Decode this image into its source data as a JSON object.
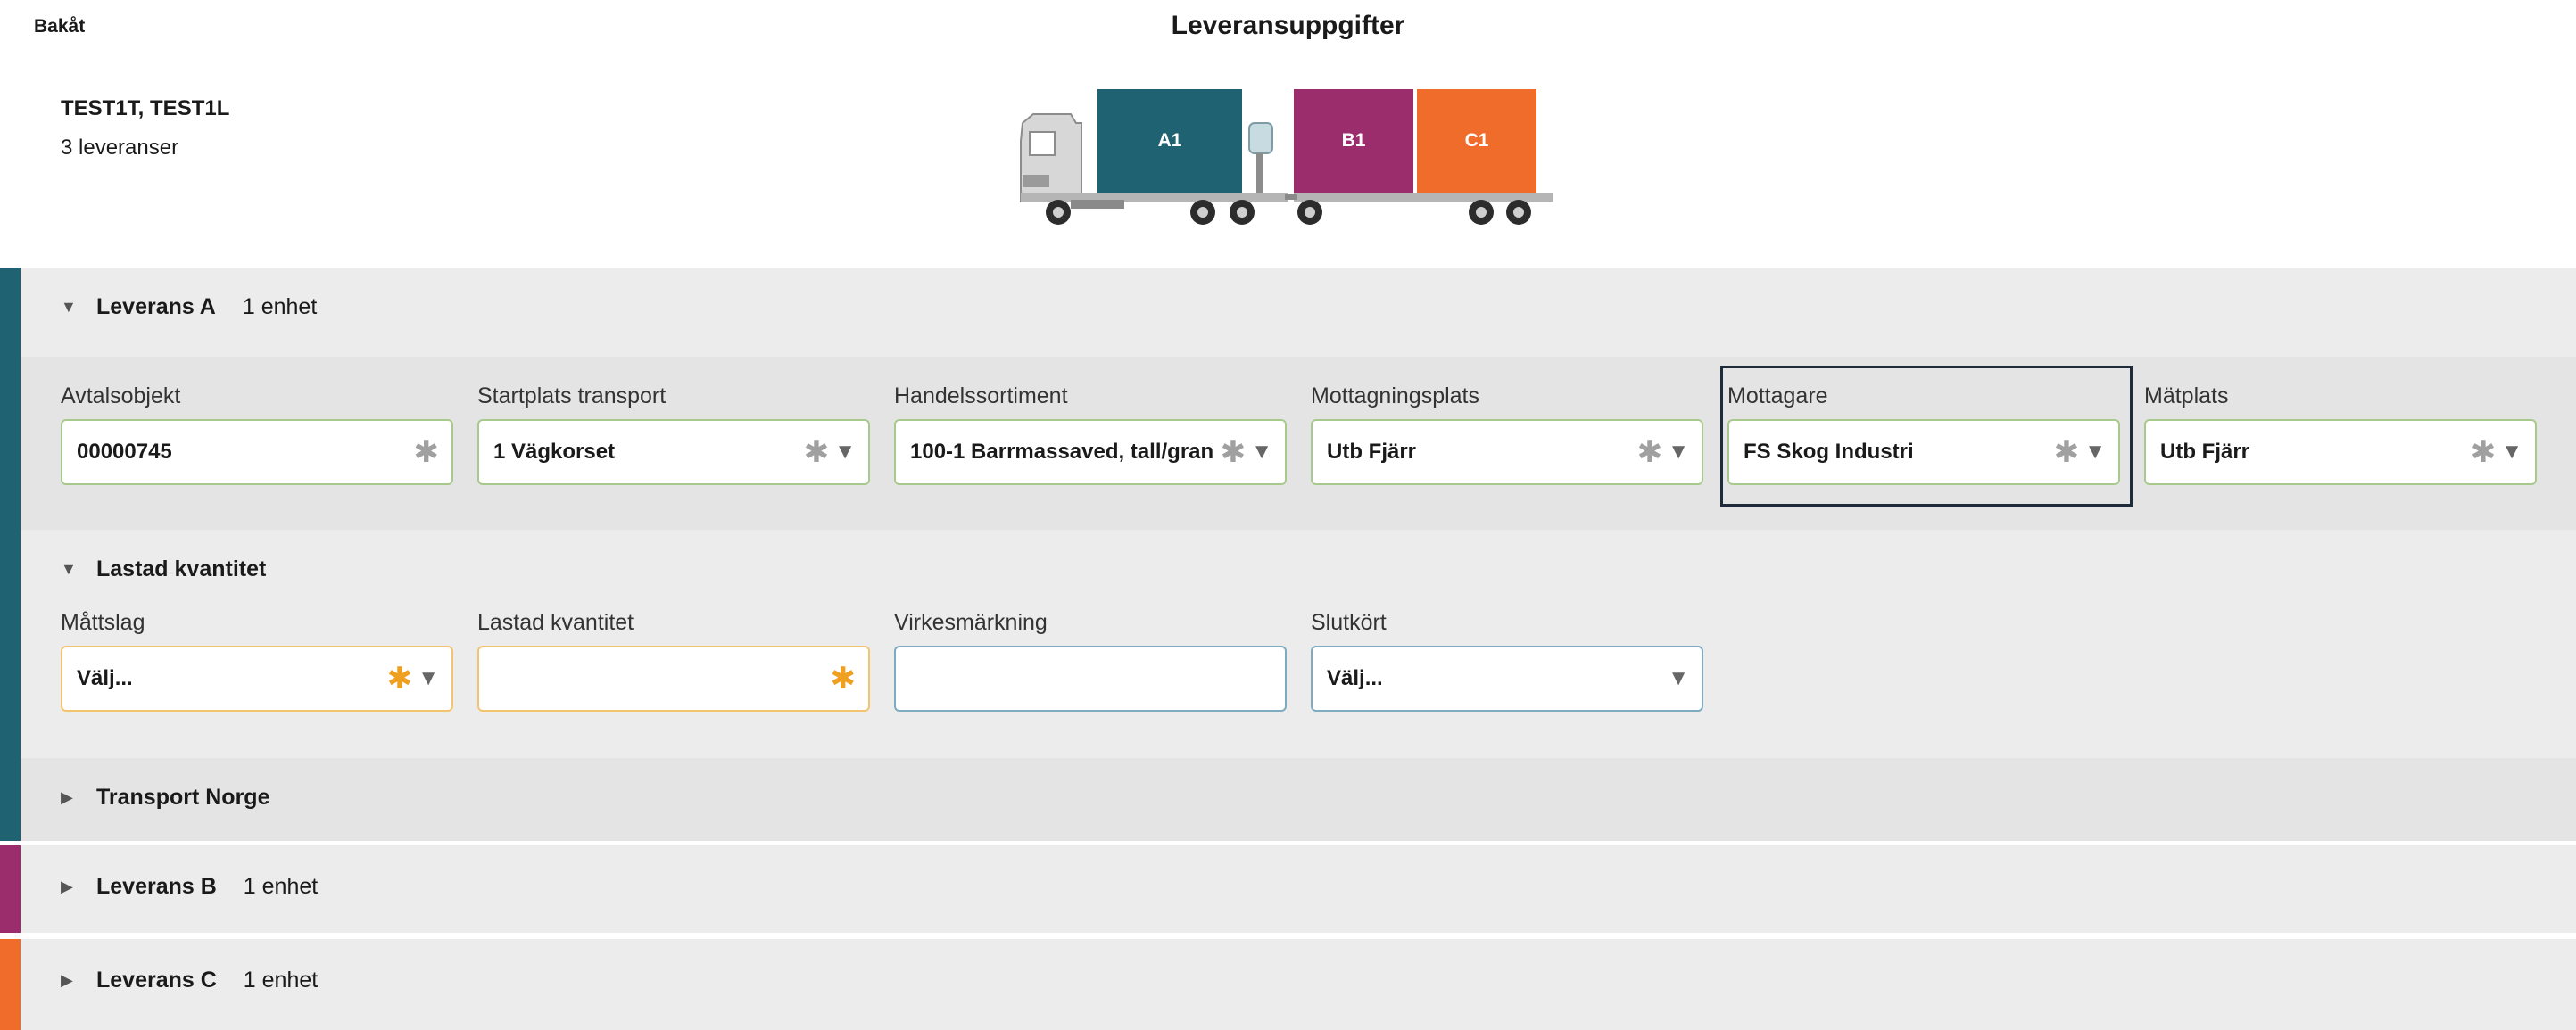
{
  "header": {
    "back_label": "Bakåt",
    "title": "Leveransuppgifter",
    "vehicle_names": "TEST1T, TEST1L",
    "delivery_count": "3 leveranser"
  },
  "truck": {
    "cargo": [
      {
        "label": "A1",
        "color": "#1f6272"
      },
      {
        "label": "B1",
        "color": "#9c2d6d"
      },
      {
        "label": "C1",
        "color": "#ef6c2a"
      }
    ]
  },
  "colors": {
    "delivery_a": "#1f6272",
    "delivery_b": "#9c2d6d",
    "delivery_c": "#ef6c2a",
    "valid_border": "#a8c98c",
    "required_border": "#f3c470",
    "required_asterisk": "#f0a020"
  },
  "delivery_a": {
    "title": "Leverans A",
    "count": "1 enhet",
    "expanded": true,
    "fields": [
      {
        "label": "Avtalsobjekt",
        "value": "00000745"
      },
      {
        "label": "Startplats transport",
        "value": "1 Vägkorset"
      },
      {
        "label": "Handelssortiment",
        "value": "100-1 Barrmassaved, tall/gran"
      },
      {
        "label": "Mottagningsplats",
        "value": "Utb Fjärr"
      },
      {
        "label": "Mottagare",
        "value": "FS Skog Industri"
      },
      {
        "label": "Mätplats",
        "value": "Utb Fjärr"
      }
    ],
    "loaded": {
      "title": "Lastad kvantitet",
      "fields": [
        {
          "label": "Måttslag",
          "value": "Välj..."
        },
        {
          "label": "Lastad kvantitet",
          "value": ""
        },
        {
          "label": "Virkesmärkning",
          "value": ""
        },
        {
          "label": "Slutkört",
          "value": "Välj..."
        }
      ]
    },
    "transport": {
      "title": "Transport Norge"
    }
  },
  "delivery_b": {
    "title": "Leverans B",
    "count": "1 enhet"
  },
  "delivery_c": {
    "title": "Leverans C",
    "count": "1 enhet"
  },
  "icons": {
    "expanded": "▼",
    "collapsed": "▶",
    "required": "✱",
    "dropdown": "▼"
  }
}
